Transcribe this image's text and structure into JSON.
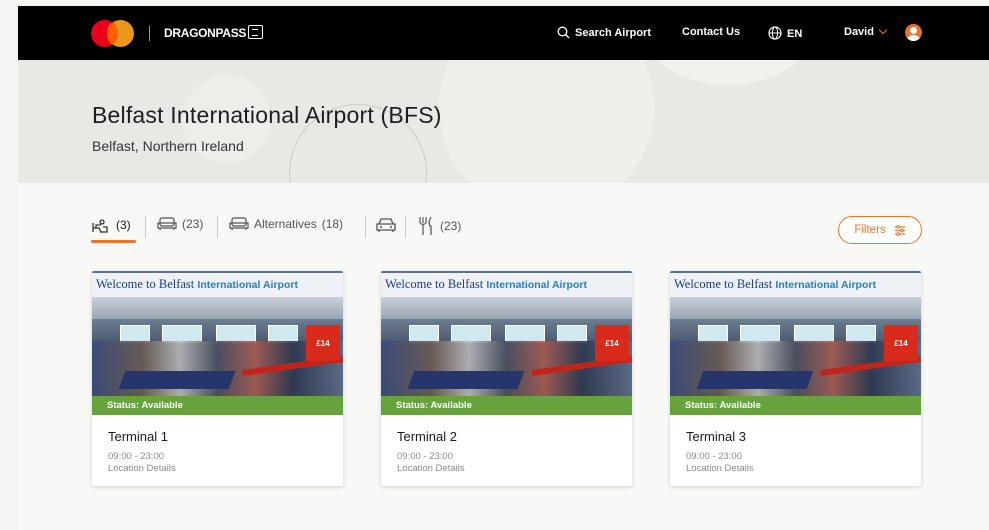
{
  "header": {
    "brand": "DRAGONPASS",
    "search_label": "Search Airport",
    "contact_label": "Contact Us",
    "language": "EN",
    "user_name": "David",
    "brand_colors": {
      "accent": "#e8732f",
      "mc_red": "#eb001b",
      "mc_orange": "#f79e1b"
    }
  },
  "hero": {
    "title": "Belfast International Airport (BFS)",
    "subtitle": "Belfast, Northern Ireland"
  },
  "tabs": [
    {
      "icon": "lounge-icon",
      "count": "(3)",
      "active": true
    },
    {
      "icon": "sofa-icon",
      "count": "(23)"
    },
    {
      "icon": "alternatives-icon",
      "label": "Alternatives",
      "count": "(18)"
    },
    {
      "icon": "car-icon",
      "count": ""
    },
    {
      "icon": "dining-icon",
      "count": "(23)"
    }
  ],
  "filters_label": "Filters",
  "cards": [
    {
      "status": "Status: Available",
      "title": "Terminal 1",
      "hours": "09:00 - 23:00",
      "location_link": "Location Details",
      "image_banner": "Welcome to Belfast",
      "image_banner_tail": "International Airport",
      "image_sign": "£14"
    },
    {
      "status": "Status: Available",
      "title": "Terminal 2",
      "hours": "09:00 - 23:00",
      "location_link": "Location Details",
      "image_banner": "Welcome to Belfast",
      "image_banner_tail": "International Airport",
      "image_sign": "£14"
    },
    {
      "status": "Status: Available",
      "title": "Terminal 3",
      "hours": "09:00 - 23:00",
      "location_link": "Location Details",
      "image_banner": "Welcome to Belfast",
      "image_banner_tail": "International Airport",
      "image_sign": "£14"
    }
  ]
}
